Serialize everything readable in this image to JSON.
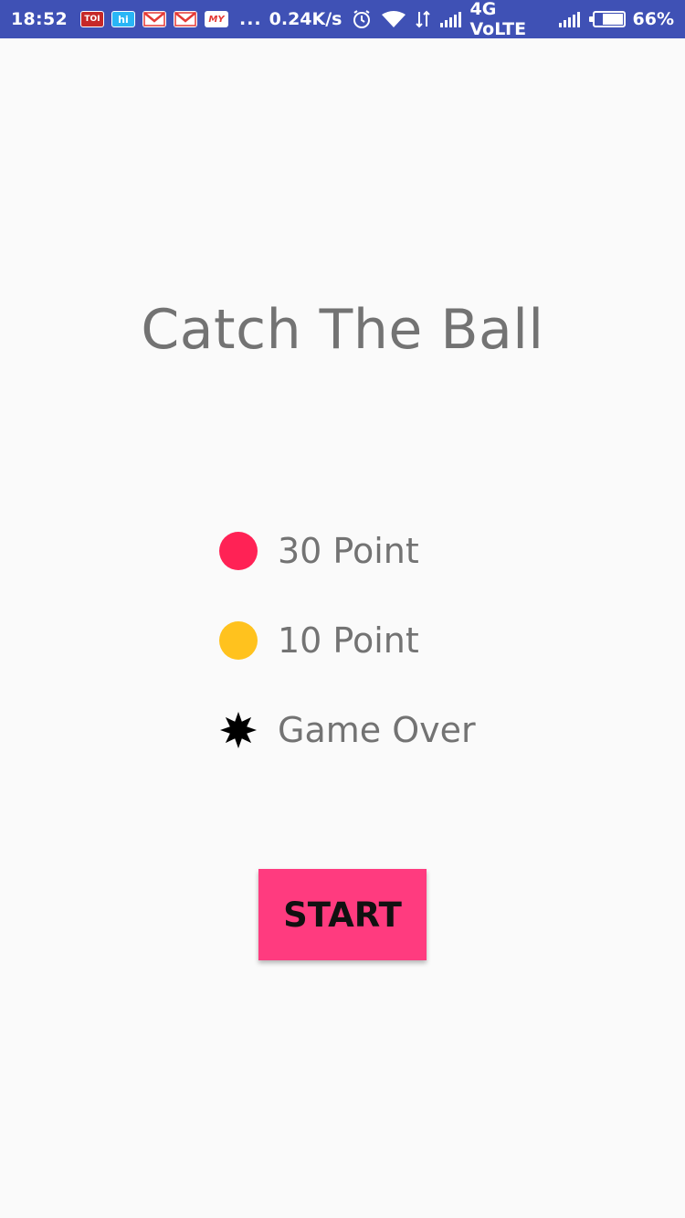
{
  "status_bar": {
    "time": "18:52",
    "notifications": [
      {
        "name": "toi-app-icon",
        "label": "TOI"
      },
      {
        "name": "hi-app-icon",
        "label": "hi"
      },
      {
        "name": "gmail-icon",
        "label": ""
      },
      {
        "name": "gmail-icon",
        "label": ""
      },
      {
        "name": "myntra-app-icon",
        "label": "MY"
      }
    ],
    "more": "...",
    "speed": "0.24K/s",
    "network": "4G VoLTE",
    "battery": "66%",
    "battery_level": 0.66
  },
  "title": "Catch The Ball",
  "legend": [
    {
      "icon": "pink-ball-icon",
      "color": "#FF2255",
      "label": "30 Point"
    },
    {
      "icon": "orange-ball-icon",
      "color": "#FFC21E",
      "label": "10 Point"
    },
    {
      "icon": "black-star-icon",
      "color": "#000000",
      "label": "Game Over"
    }
  ],
  "start_button": {
    "label": "START",
    "color": "#FF3B7F"
  },
  "colors": {
    "status_bar": "#3F51B5",
    "background": "#FAFAFA",
    "text": "#737373"
  }
}
